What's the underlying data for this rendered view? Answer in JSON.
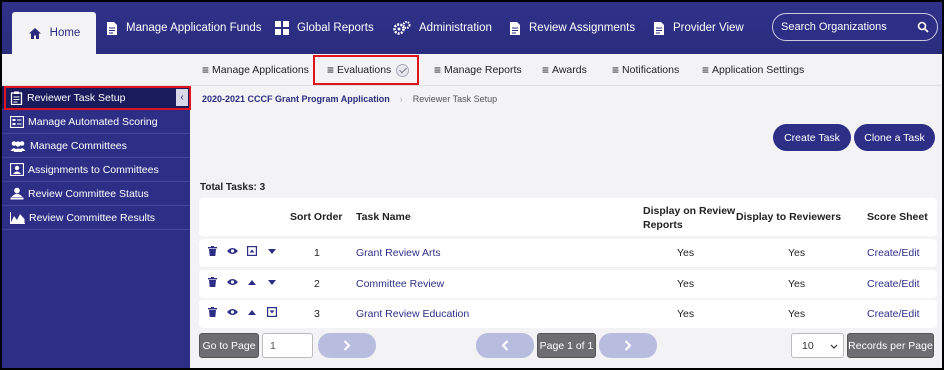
{
  "topnav": {
    "tabs": [
      {
        "label": "Home",
        "icon": "home-icon"
      },
      {
        "label": "Manage Application Funds",
        "icon": "document-icon"
      },
      {
        "label": "Global Reports",
        "icon": "grid-icon"
      },
      {
        "label": "Administration",
        "icon": "gears-icon"
      },
      {
        "label": "Review Assignments",
        "icon": "document-icon"
      },
      {
        "label": "Provider View",
        "icon": "document-icon"
      }
    ],
    "search_placeholder": "Search Organizations"
  },
  "subnav": {
    "items": [
      "Manage Applications",
      "Evaluations",
      "Manage Reports",
      "Awards",
      "Notifications",
      "Application Settings"
    ]
  },
  "sidebar": {
    "items": [
      "Reviewer Task Setup",
      "Manage Automated Scoring",
      "Manage Committees",
      "Assignments to Committees",
      "Review Committee Status",
      "Review Committee Results"
    ]
  },
  "breadcrumb": {
    "parent": "2020-2021 CCCF Grant Program Application",
    "current": "Reviewer Task Setup"
  },
  "actions": {
    "create": "Create Task",
    "clone": "Clone a Task"
  },
  "total_tasks": "Total Tasks: 3",
  "table": {
    "headers": {
      "sort_order": "Sort Order",
      "task_name": "Task Name",
      "display_on_review_line1": "Display on Review",
      "display_on_review_line2": "Reports",
      "display_to_reviewers": "Display to Reviewers",
      "score_sheet": "Score Sheet"
    },
    "rows": [
      {
        "sort": "1",
        "name": "Grant Review Arts",
        "display_reports": "Yes",
        "display_reviewers": "Yes",
        "score": "Create/Edit"
      },
      {
        "sort": "2",
        "name": "Committee Review",
        "display_reports": "Yes",
        "display_reviewers": "Yes",
        "score": "Create/Edit"
      },
      {
        "sort": "3",
        "name": "Grant Review Education",
        "display_reports": "Yes",
        "display_reviewers": "Yes",
        "score": "Create/Edit"
      }
    ]
  },
  "pager": {
    "go_to_page": "Go to Page",
    "page_value": "1",
    "page_label": "Page 1 of 1",
    "records_value": "10",
    "records_per_page": "Records per Page"
  },
  "colors": {
    "brand": "#2d2f86",
    "highlight": "#e0141e"
  }
}
